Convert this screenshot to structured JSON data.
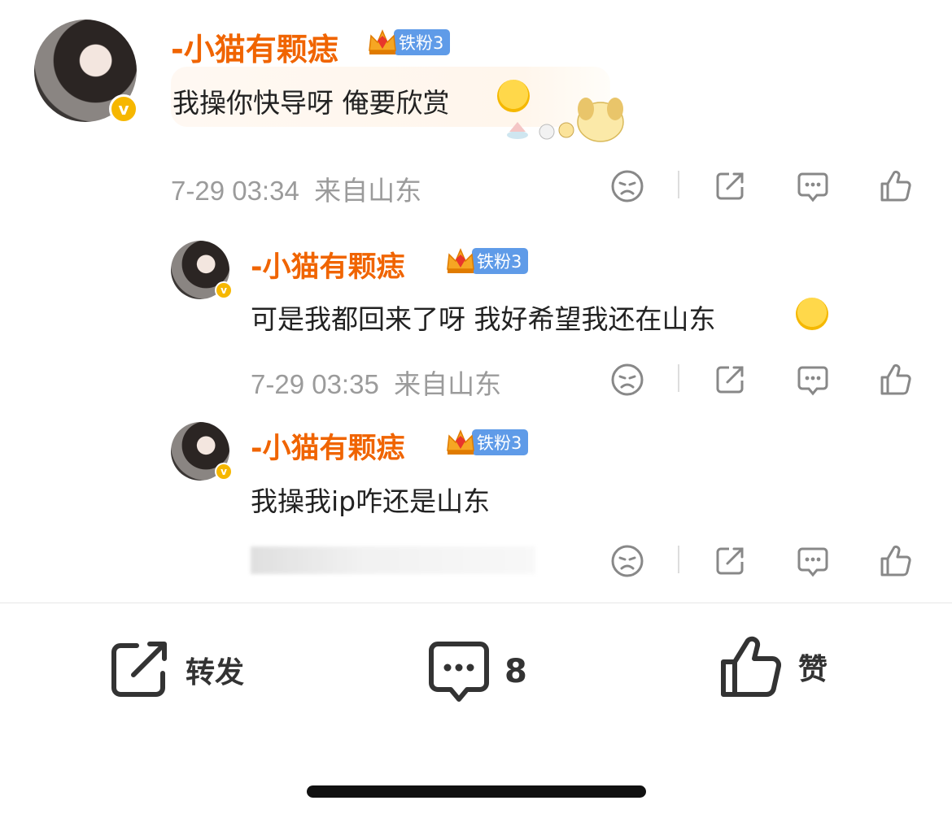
{
  "comments": [
    {
      "username": "-小猫有颗痣",
      "badge": "铁粉3",
      "text": "我操你快导呀 俺要欣赏",
      "time": "7-29 03:34",
      "location": "来自山东"
    },
    {
      "username": "-小猫有颗痣",
      "badge": "铁粉3",
      "text": "可是我都回来了呀 我好希望我还在山东",
      "time": "7-29 03:35",
      "location": "来自山东"
    },
    {
      "username": "-小猫有颗痣",
      "badge": "铁粉3",
      "text": "我操我ip咋还是山东"
    }
  ],
  "bottom_bar": {
    "repost_label": "转发",
    "comment_count": "8",
    "like_label": "赞"
  },
  "colors": {
    "username": "#f06400",
    "badge_bg": "#5f9be8",
    "meta": "#9b9b9b",
    "verified": "#f6b700"
  }
}
